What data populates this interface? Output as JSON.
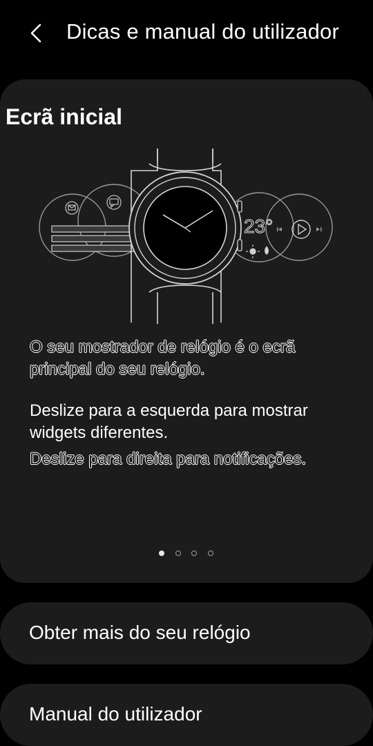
{
  "header": {
    "back_icon": "chevron-left-icon",
    "title": "Dicas e manual do utilizador"
  },
  "card": {
    "title": "Ecrã inicial",
    "illustration": {
      "icons": [
        "mail-icon",
        "chat-icon",
        "sun-icon",
        "water-drop-icon",
        "previous-icon",
        "play-icon",
        "next-icon"
      ],
      "temperature": "23°"
    },
    "paragraph1": "O seu mostrador de relógio é o ecrã principal do seu relógio.",
    "paragraph2": "Deslize para a esquerda para mostrar widgets diferentes.",
    "paragraph3": "Deslize para direita para notificações.",
    "pagination": {
      "total": 4,
      "current": 1
    }
  },
  "buttons": {
    "more": "Obter mais do seu relógio",
    "manual": "Manual do utilizador"
  },
  "colors": {
    "background": "#000000",
    "card": "#1c1c1c",
    "text": "#ffffff"
  }
}
